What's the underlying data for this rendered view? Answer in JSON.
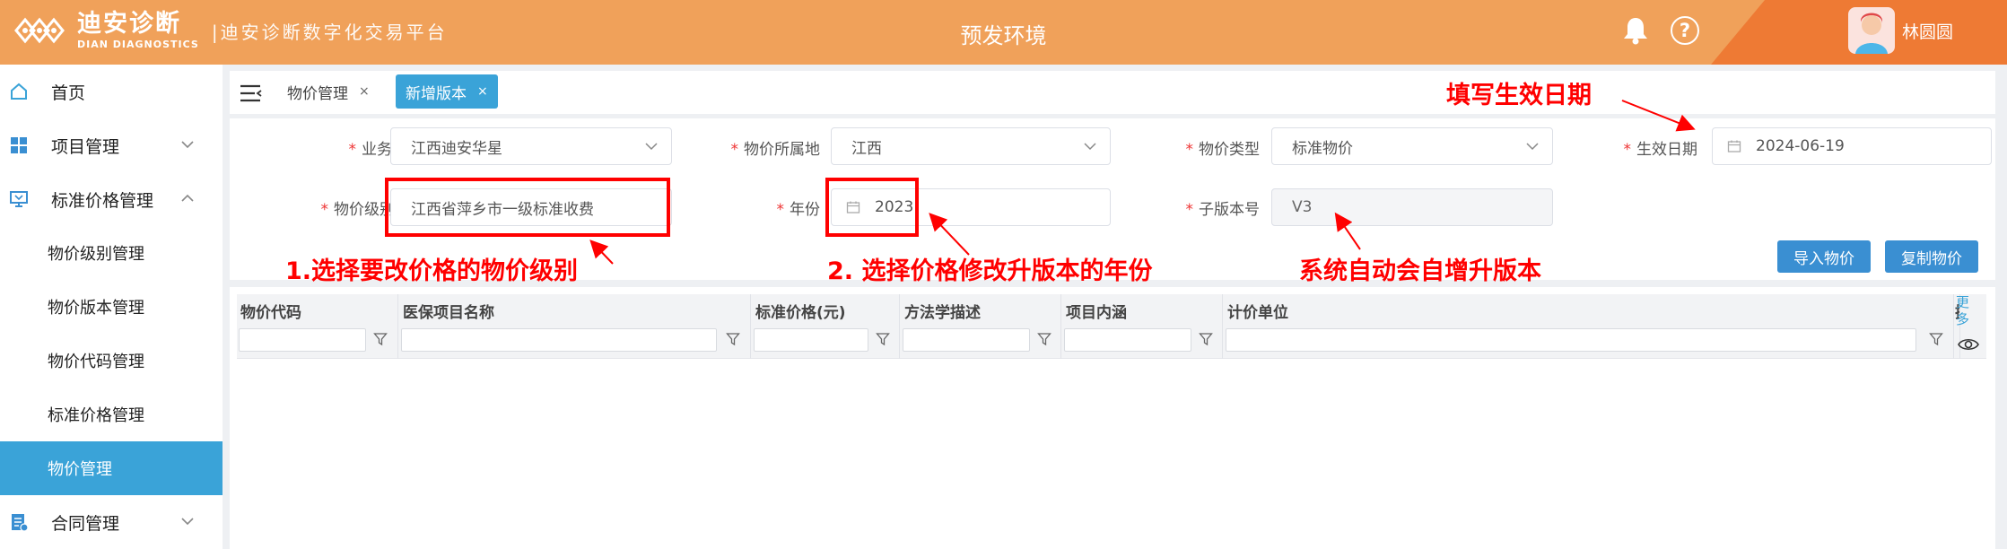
{
  "header": {
    "brand_cn": "迪安诊断",
    "brand_en": "DIAN DIAGNOSTICS",
    "platform": "|迪安诊断数字化交易平台",
    "environment": "预发环境",
    "user_name": "林圆圆",
    "help_glyph": "?"
  },
  "sidebar": {
    "home": "首页",
    "project_mgmt": "项目管理",
    "std_price_mgmt": "标准价格管理",
    "sub_items": [
      "物价级别管理",
      "物价版本管理",
      "物价代码管理",
      "标准价格管理",
      "物价管理"
    ],
    "contract_mgmt": "合同管理"
  },
  "tabs": [
    {
      "label": "物价管理",
      "close": "×"
    },
    {
      "label": "新增版本",
      "close": "×"
    }
  ],
  "form": {
    "business_label": "业务归属",
    "business_value": "江西迪安华星",
    "location_label": "物价所属地",
    "location_value": "江西",
    "type_label": "物价类型",
    "type_value": "标准物价",
    "effective_label": "生效日期",
    "effective_value": "2024-06-19",
    "level_name_label": "物价级别名称",
    "level_name_value": "江西省萍乡市一级标准收费",
    "year_label": "年份",
    "year_value": "2023",
    "subversion_label": "子版本号",
    "subversion_value": "V3",
    "required_mark": "*",
    "import_button": "导入物价",
    "copy_button": "复制物价"
  },
  "table": {
    "columns": [
      "物价代码",
      "医保项目名称",
      "标准价格(元)",
      "方法学描述",
      "项目内涵",
      "计价单位"
    ],
    "more": "更多",
    "partial_header": "操"
  },
  "annotations": {
    "a1": "1.选择要改价格的物价级别",
    "a2": "2. 选择价格修改升版本的年份",
    "a3": "系统自动会自增升版本",
    "a4": "填写生效日期"
  },
  "colors": {
    "header_orange": "#f0a15a",
    "header_dark_orange": "#ee7a34",
    "accent_blue": "#3aa3d8",
    "annotation_red": "#ff0000"
  }
}
